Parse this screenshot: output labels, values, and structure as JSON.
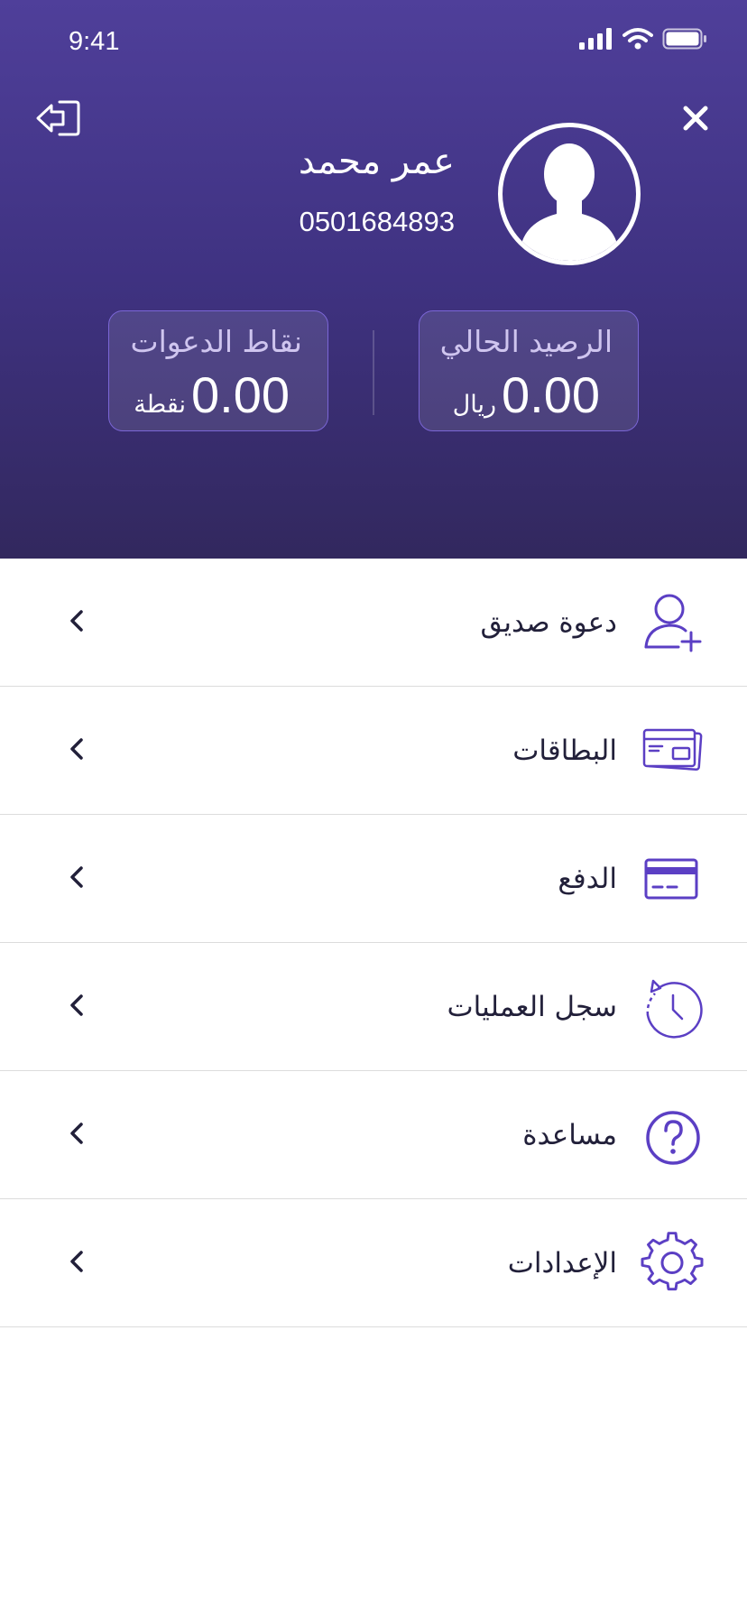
{
  "status_bar": {
    "time": "9:41"
  },
  "user": {
    "name": "عمر محمد",
    "phone": "0501684893"
  },
  "stats": {
    "balance": {
      "label": "الرصيد الحالي",
      "value": "0.00",
      "unit": "ريال"
    },
    "points": {
      "label": "نقاط الدعوات",
      "value": "0.00",
      "unit": "نقطة"
    }
  },
  "menu": [
    {
      "label": "دعوة صديق",
      "icon": "add-user-icon"
    },
    {
      "label": "البطاقات",
      "icon": "cards-icon"
    },
    {
      "label": "الدفع",
      "icon": "credit-card-icon"
    },
    {
      "label": "سجل العمليات",
      "icon": "history-icon"
    },
    {
      "label": "مساعدة",
      "icon": "help-icon"
    },
    {
      "label": "الإعدادات",
      "icon": "gear-icon"
    }
  ],
  "colors": {
    "header_top": "#4f3f9a",
    "header_bottom": "#32285e",
    "accent": "#5b3fc4",
    "card_border": "#7b66d6"
  }
}
